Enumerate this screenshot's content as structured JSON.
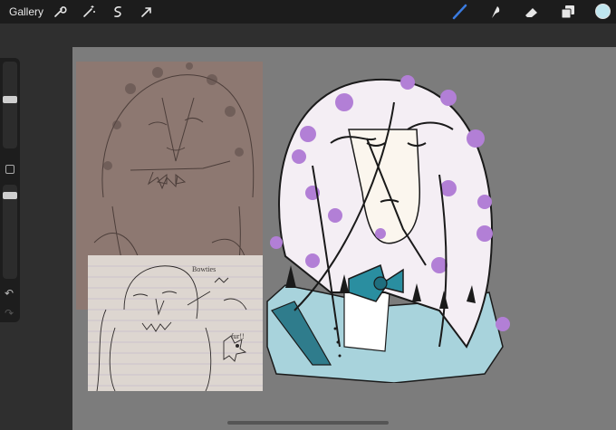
{
  "toolbar": {
    "gallery_label": "Gallery",
    "left_tools": [
      "wrench-icon",
      "magic-wand-icon",
      "selection-icon",
      "transform-arrow-icon"
    ],
    "right_tools": [
      "brush-icon",
      "smudge-icon",
      "eraser-icon",
      "layers-icon"
    ],
    "color": "#bfe6ef",
    "brush_accent": "#3a7be0"
  },
  "sidebar": {
    "brush_size_level": 0.45,
    "opacity_level": 0.25,
    "undo_label": "↶",
    "redo_label": "↷"
  },
  "canvas": {
    "background": "#7c7c7c"
  },
  "reference_sketch_2": {
    "note1": "Bowties",
    "note2": "fur!!"
  },
  "artwork": {
    "hair_color": "#f3edf3",
    "dot_color": "#b27fd6",
    "jacket_color": "#a8d3dc",
    "bowtie_color": "#2a8ea0",
    "skin_color": "#fbf6ee"
  }
}
